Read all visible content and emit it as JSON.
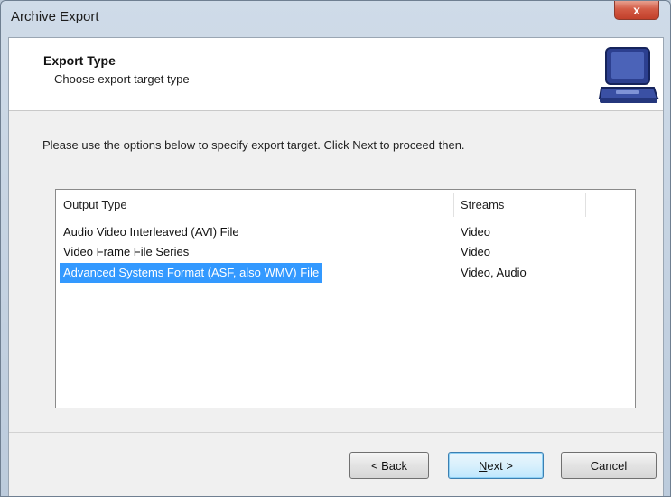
{
  "window": {
    "title": "Archive Export",
    "close_label": "x"
  },
  "header": {
    "title": "Export Type",
    "subtitle": "Choose export target type",
    "icon": "laptop-case-icon"
  },
  "instruction": "Please use the options below to specify export target. Click Next to proceed then.",
  "list": {
    "columns": [
      "Output Type",
      "Streams"
    ],
    "rows": [
      {
        "type": "Audio Video Interleaved (AVI) File",
        "streams": "Video",
        "selected": false
      },
      {
        "type": "Video Frame File Series",
        "streams": "Video",
        "selected": false
      },
      {
        "type": "Advanced Systems Format (ASF, also WMV) File",
        "streams": "Video, Audio",
        "selected": true
      }
    ]
  },
  "buttons": {
    "back": "< Back",
    "next_underlined": "N",
    "next_rest": "ext >",
    "cancel": "Cancel"
  },
  "colors": {
    "selection": "#3399ff",
    "close_button": "#c2402b",
    "default_button_border": "#3c7fb1"
  }
}
